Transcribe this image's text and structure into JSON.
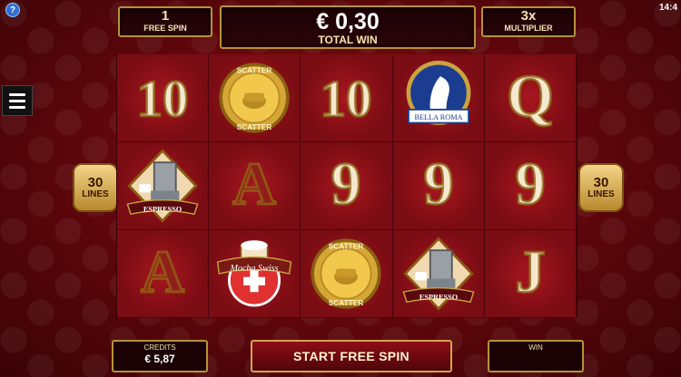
{
  "status": {
    "clock": "14:4"
  },
  "top": {
    "free_spin": {
      "count": "1",
      "label": "FREE SPIN"
    },
    "total_win": {
      "amount": "€ 0,30",
      "label": "TOTAL WIN"
    },
    "multiplier": {
      "value": "3x",
      "label": "MULTIPLIER"
    }
  },
  "lines": {
    "count": "30",
    "label": "LINES"
  },
  "reels": [
    [
      "10",
      "scatter",
      "10",
      "bella-roma",
      "Q"
    ],
    [
      "espresso",
      "A",
      "9",
      "9",
      "9"
    ],
    [
      "A",
      "mocha-swiss",
      "scatter",
      "espresso",
      "J"
    ]
  ],
  "symbol_text": {
    "scatter": "SCATTER",
    "bella_roma": "BELLA ROMA",
    "espresso": "ESPRESSO",
    "mocha": "Mocha Swiss"
  },
  "bottom": {
    "credits_label": "CREDITS",
    "credits_value": "€ 5,87",
    "start_label": "START FREE SPIN",
    "win_label": "WIN"
  },
  "colors": {
    "gold": "#b8923a",
    "background": "#6a0a10",
    "accent": "#d3a64a"
  }
}
